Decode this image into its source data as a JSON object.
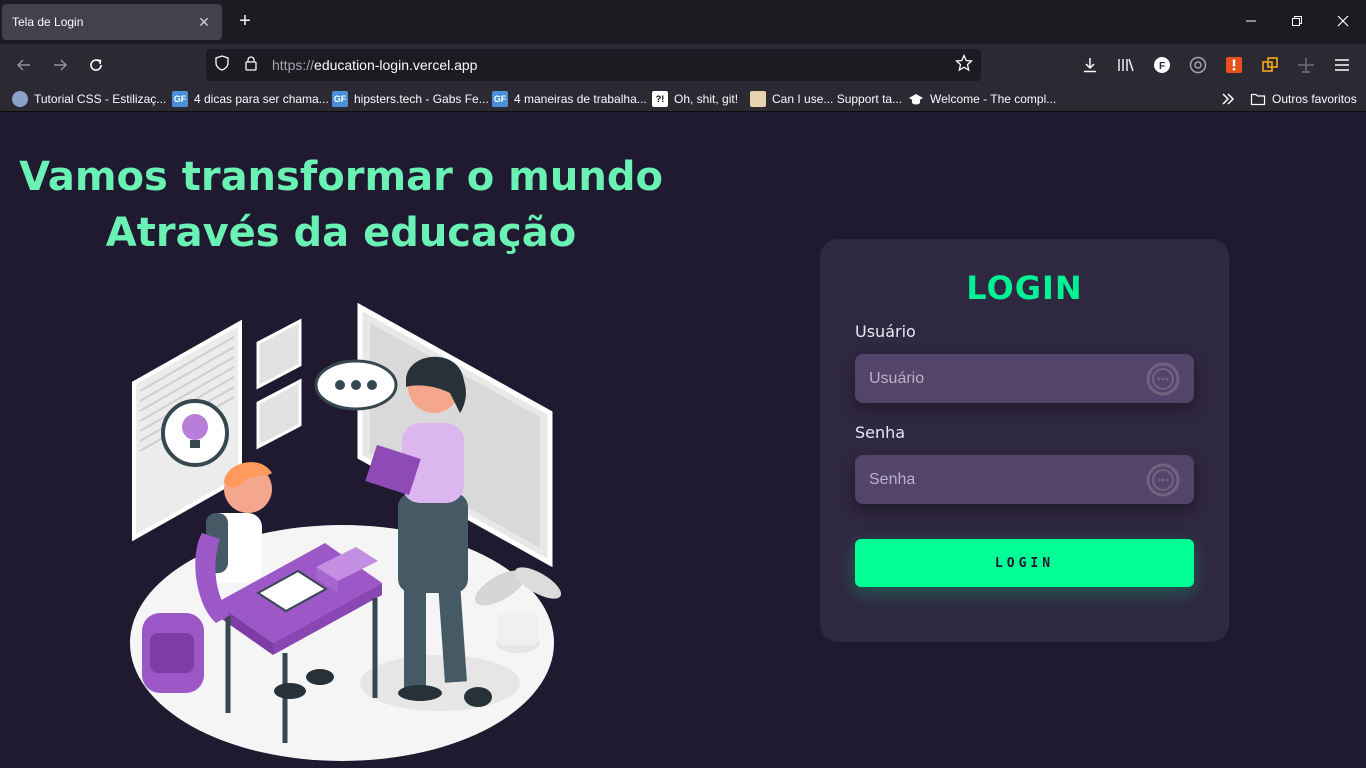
{
  "browser": {
    "tab": {
      "title": "Tela de Login"
    },
    "url": {
      "scheme": "https://",
      "host": "education-login.vercel.app"
    },
    "bookmarks": [
      {
        "label": "Tutorial CSS - Estilizaç...",
        "icon": "avatar-favicon"
      },
      {
        "label": "4 dicas para ser chama...",
        "icon": "gf-favicon"
      },
      {
        "label": "hipsters.tech - Gabs Fe...",
        "icon": "gf-favicon"
      },
      {
        "label": "4 maneiras de trabalha...",
        "icon": "gf-favicon"
      },
      {
        "label": "Oh, shit, git!",
        "icon": "question-favicon"
      },
      {
        "label": "Can I use... Support ta...",
        "icon": "caniuse-favicon"
      },
      {
        "label": "Welcome - The compl...",
        "icon": "graduation-cap-favicon"
      }
    ],
    "other_bookmarks": "Outros favoritos"
  },
  "page": {
    "headline_line1": "Vamos transformar o mundo",
    "headline_line2": "Através da educação"
  },
  "login": {
    "title": "LOGIN",
    "user_label": "Usuário",
    "user_placeholder": "Usuário",
    "password_label": "Senha",
    "password_placeholder": "Senha",
    "button_label": "LOGIN"
  },
  "colors": {
    "background": "#1f1a30",
    "headline": "#6af2b5",
    "card": "#2f2841",
    "input": "#534569",
    "accent": "#00ff95"
  }
}
